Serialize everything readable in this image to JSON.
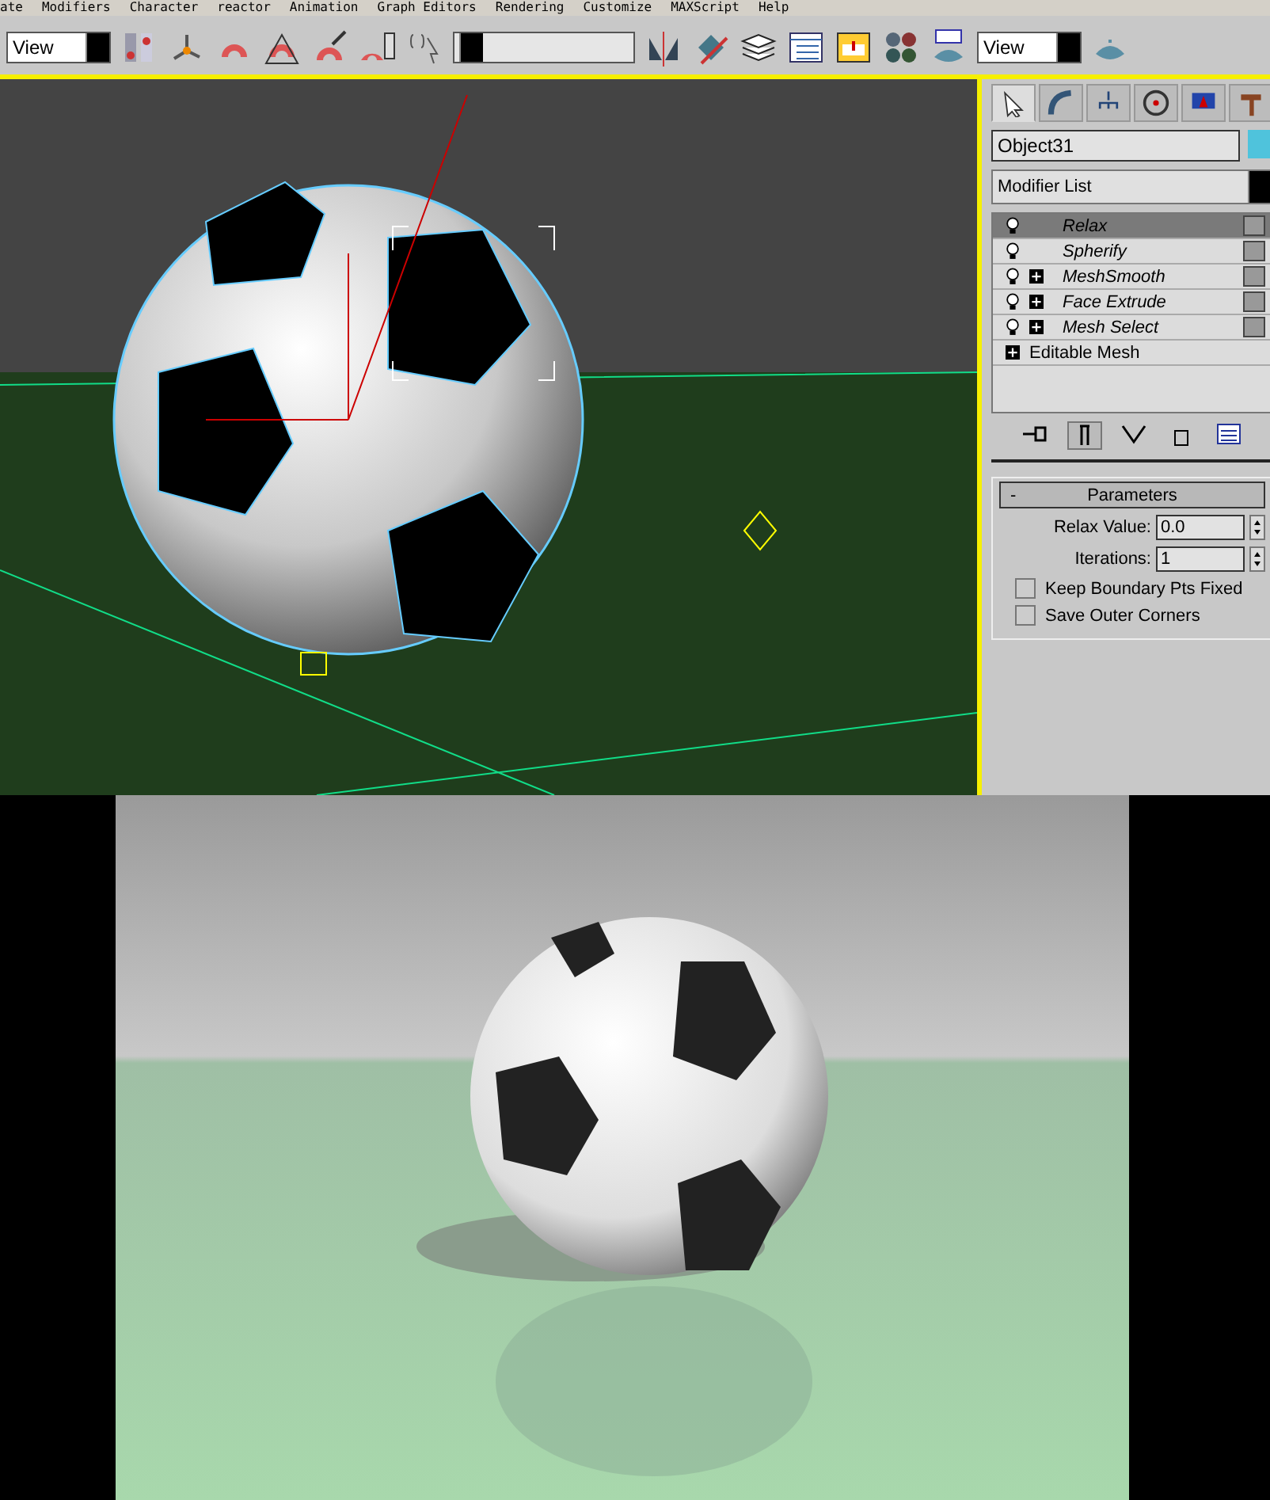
{
  "menu_bar": [
    "ate",
    "Modifiers",
    "Character",
    "reactor",
    "Animation",
    "Graph Editors",
    "Rendering",
    "Customize",
    "MAXScript",
    "Help"
  ],
  "toolbar": {
    "left_view": "View",
    "right_view": "View"
  },
  "command_panel": {
    "tabs": [
      {
        "selected": true
      },
      {
        "selected": false
      },
      {
        "selected": false
      },
      {
        "selected": false
      },
      {
        "selected": false
      },
      {
        "selected": false
      }
    ],
    "object_name": "Object31",
    "color": "#4fc3dc",
    "modifier_list": "Modifier List",
    "stack": [
      {
        "name": "Relax",
        "kind": "modifier",
        "expandable": false,
        "selected": true
      },
      {
        "name": "Spherify",
        "kind": "modifier",
        "expandable": false,
        "selected": false
      },
      {
        "name": "MeshSmooth",
        "kind": "modifier",
        "expandable": true,
        "selected": false
      },
      {
        "name": "Face Extrude",
        "kind": "modifier",
        "expandable": true,
        "selected": false
      },
      {
        "name": "Mesh Select",
        "kind": "modifier",
        "expandable": true,
        "selected": false
      },
      {
        "name": "Editable Mesh",
        "kind": "base",
        "expandable": true,
        "selected": false
      }
    ],
    "rollout": {
      "title": "Parameters",
      "toggle": "-",
      "expanded": true,
      "spinners": [
        {
          "label": "Relax Value:",
          "value": "0.0"
        },
        {
          "label": "Iterations:",
          "value": "1"
        }
      ],
      "checkboxes": [
        {
          "label": "Keep Boundary Pts Fixed",
          "checked": false
        },
        {
          "label": "Save Outer Corners",
          "checked": false
        }
      ]
    }
  }
}
